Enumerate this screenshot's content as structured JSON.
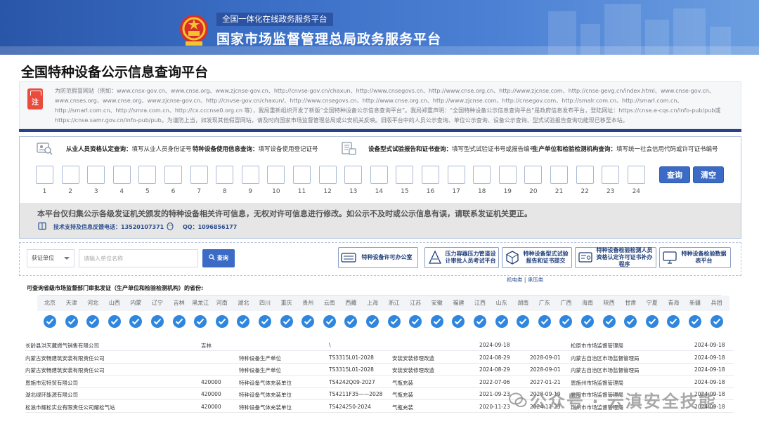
{
  "header": {
    "subtitle": "全国一体化在线政务服务平台",
    "title": "国家市场监督管理总局政务服务平台"
  },
  "page": {
    "title": "全国特种设备公示信息查询平台"
  },
  "notice": {
    "badge": "注",
    "text": "为防范假冒网站（例如：www.cnsx-gov.cn、www.cnse.org、www.zjcnse-gov.cn、http://cnvse-gov.cn/chaxun、http://www.cnsegovs.cn、http://www.cnse.org.cn、http://www.zjcnse.com、http://cnse-gevg.cn/index.html、www.cnse-gov.cn、www.cnses.org、www.cnse.org、www.zjcnse-gov.cn、http://cnvse-gov.cn/chaxun/、http://www.cnsegovs.cn、http://www.cnse.org.cn、http://www.zjcnse.com、http://cnsegov.com、http://smalr.com.cn、http://smarl.com.cn、http://smarl.com.cn、http://smra.com.cn、http://cx.cccnse0.org.cn 等），我局重新组织开发了新版“全国特种设备公示信息查询平台”。我局郑重声明：“全国特种设备公示信息查询平台”是政府信息发布平台，登陆网址：https://cnse.e-cqs.cn/info-pub/pub或https://cnse.samr.gov.cn/info-pub/pub。为谨防上当，如发现其他假冒网站，请及时向国家市场监督管理总局或公安机关反映。旧版平台中的人员公示查询、单位公示查询、设备公示查询、型式试验报告查询功能现已移至本站。"
  },
  "query": {
    "categories": [
      {
        "name": "从业人员资格认定查询：",
        "hint": "填写从业人员身份证号"
      },
      {
        "name": "特种设备使用信息查询：",
        "hint": "填写设备使用登记证号"
      },
      {
        "name": "设备型式试验报告和证书查询：",
        "hint": "填写型式试验证书号或报告编号"
      },
      {
        "name": "生产单位和检验检测机构查询：",
        "hint": "填写统一社会信用代码或许可证书编号"
      }
    ],
    "box_numbers": [
      "1",
      "2",
      "3",
      "4",
      "5",
      "6",
      "7",
      "8",
      "9",
      "10",
      "11",
      "12",
      "13",
      "14",
      "15",
      "16",
      "17",
      "18",
      "19",
      "20",
      "21",
      "22",
      "23",
      "24"
    ],
    "search_label": "查询",
    "clear_label": "清空",
    "disclaimer": "本平台仅归集公示各级发证机关颁发的特种设备相关许可信息，无权对许可信息进行修改。如公示不及时或公示信息有误，请联系发证机关更正。",
    "support_label": "技术支持及信息反馈电话：",
    "support_phone": "13520107371",
    "qq_label": "QQ：",
    "qq_value": "1096856177"
  },
  "search_bar": {
    "select_value": "获证单位",
    "input_placeholder": "请输入单位名称",
    "search_label": "查询",
    "platforms": [
      {
        "label": "特种设备许可办公室"
      },
      {
        "label": "压力容器压力管道设计审批人员考试平台"
      },
      {
        "label": "特种设备型式试验报告和证书提交"
      },
      {
        "label": "特种设备检验检测人员资格认定许可证书补办程序"
      },
      {
        "label": "特种设备检验数据表平台"
      }
    ],
    "platform_tabs": "机电类 | 承压类"
  },
  "provinces": {
    "title": "可查询省级市场监督部门审批发证（生产单位和检验检测机构）的省份:",
    "items": [
      "北京",
      "天津",
      "河北",
      "山西",
      "内蒙",
      "辽宁",
      "吉林",
      "黑龙江",
      "河南",
      "湖北",
      "四川",
      "重庆",
      "贵州",
      "云南",
      "西藏",
      "上海",
      "浙江",
      "江苏",
      "安徽",
      "福建",
      "江西",
      "山东",
      "湖南",
      "广东",
      "广西",
      "海南",
      "陕西",
      "甘肃",
      "宁夏",
      "青海",
      "新疆",
      "兵团"
    ]
  },
  "table": {
    "rows": [
      [
        "长龄县洪天藏燃气销售有限公司",
        "吉林",
        "",
        "\\",
        "",
        "2024-09-18",
        "",
        "松原市市场监督管理局",
        "2024-09-18"
      ],
      [
        "内蒙古安畅建筑安装有限责任公司",
        "",
        "特种设备生产单位",
        "TS3315L01-2028",
        "安装安装修理改造",
        "2024-08-29",
        "2028-09-01",
        "内蒙古自治区市场监督管理局",
        "2024-09-18"
      ],
      [
        "内蒙古安畅建筑安装有限责任公司",
        "",
        "特种设备生产单位",
        "TS3315L01-2028",
        "安装安装修理改造",
        "2024-08-29",
        "2028-09-01",
        "内蒙古自治区市场监督管理局",
        "2024-09-18"
      ],
      [
        "恩施市宏特贸有限公司",
        "420000",
        "特种设备气体充装单位",
        "TS4242Q09-2027",
        "气瓶充装",
        "2022-07-06",
        "2027-01-21",
        "恩施州市场监督管理局",
        "2024-09-18"
      ],
      [
        "湖北绿环能源有限公司",
        "420000",
        "特种设备气体充装单位",
        "TS4211F35——2028",
        "气瓶充装",
        "2021-09-23",
        "2028-09-19",
        "襄阳市市场监督管理局",
        "2024-09-18"
      ],
      [
        "松滋市耀松实业有限责任公司耀松气站",
        "420000",
        "特种设备气体充装单位",
        "TS424250-2024",
        "气瓶充装",
        "2020-11-23",
        "2024-11-23",
        "荆州市市场监督管理局",
        "2024-09-18"
      ]
    ]
  },
  "watermark": "公众号 · 云滇安全技能"
}
